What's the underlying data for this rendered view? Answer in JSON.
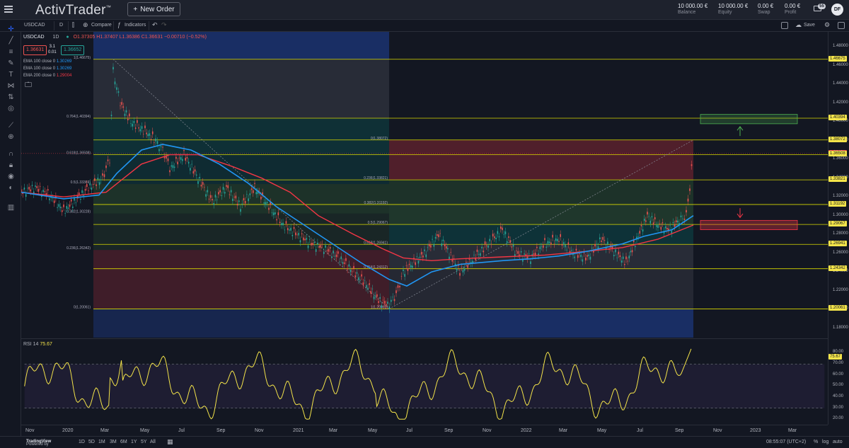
{
  "app": {
    "brand": "ActivTrader",
    "brand_tm": "™",
    "new_order_label": "New Order"
  },
  "account": [
    {
      "value": "10 000.00 €",
      "label": "Balance"
    },
    {
      "value": "10 000.00 €",
      "label": "Equity"
    },
    {
      "value": "0.00 €",
      "label": "Swap"
    },
    {
      "value": "0.00 €",
      "label": "Profit"
    }
  ],
  "notifications": {
    "count": "55"
  },
  "user": {
    "initials": "DF"
  },
  "chart_toolbar": {
    "symbol": "USDCAD",
    "interval": "D",
    "compare_label": "Compare",
    "indicators_label": "Indicators",
    "save_label": "Save"
  },
  "legend": {
    "symbol": "USDCAD",
    "interval": "1D",
    "ohlc": "O1.37305  H1.37407  L1.36386  C1.36631  −0.00710 (−0.52%)",
    "sell_price": "1.36631",
    "spread": "3.1",
    "lot": "0.01",
    "buy_price": "1.36652",
    "emas": [
      {
        "label": "EMA 100 close 0",
        "value": "1.30269",
        "color": "#2196f3"
      },
      {
        "label": "EMA 100 close 0",
        "value": "1.30269",
        "color": "#2196f3"
      },
      {
        "label": "EMA 200 close 0",
        "value": "1.29004",
        "color": "#f23645"
      }
    ]
  },
  "fib_left": [
    {
      "label": "1(1.46675)",
      "value": 1.46675
    },
    {
      "label": "0.764(1.40394)",
      "value": 1.40394
    },
    {
      "label": "0.618(1.36508)",
      "value": 1.36508
    },
    {
      "label": "0.5(1.33369)",
      "value": 1.33369
    },
    {
      "label": "0.382(1.30228)",
      "value": 1.30228
    },
    {
      "label": "0.236(1.26342)",
      "value": 1.26342
    },
    {
      "label": "0(1.20061)",
      "value": 1.20061
    }
  ],
  "fib_right": [
    {
      "label": "0(1.38072)",
      "value": 1.38072
    },
    {
      "label": "0.236(1.33821)",
      "value": 1.33821
    },
    {
      "label": "0.382(1.31192)",
      "value": 1.31192
    },
    {
      "label": "0.5(1.29067)",
      "value": 1.29067
    },
    {
      "label": "0.618(1.26941)",
      "value": 1.26941
    },
    {
      "label": "0.764(1.24312)",
      "value": 1.24312
    },
    {
      "label": "1(1.20061)",
      "value": 1.20061
    }
  ],
  "price_scale": {
    "ticks": [
      "1.48000",
      "1.46000",
      "1.44000",
      "1.42000",
      "1.40000",
      "1.38000",
      "1.36000",
      "1.34000",
      "1.32000",
      "1.30000",
      "1.28000",
      "1.26000",
      "1.24000",
      "1.22000",
      "1.20000",
      "1.18000"
    ],
    "levels": [
      {
        "label": "1.46675",
        "value": 1.46675,
        "kind": "level"
      },
      {
        "label": "1.40394",
        "value": 1.40394,
        "kind": "level"
      },
      {
        "label": "1.38072",
        "value": 1.38072,
        "kind": "level"
      },
      {
        "label": "1.36631",
        "value": 1.36631,
        "kind": "current"
      },
      {
        "label": "1.36508",
        "value": 1.36508,
        "kind": "level"
      },
      {
        "label": "1.33821",
        "value": 1.33821,
        "kind": "level"
      },
      {
        "label": "1.31192",
        "value": 1.31192,
        "kind": "level"
      },
      {
        "label": "1.29067",
        "value": 1.29067,
        "kind": "level"
      },
      {
        "label": "1.26941",
        "value": 1.26941,
        "kind": "level"
      },
      {
        "label": "1.24342",
        "value": 1.24342,
        "kind": "level"
      },
      {
        "label": "1.20061",
        "value": 1.20061,
        "kind": "level"
      }
    ],
    "ymin": 1.17,
    "ymax": 1.496
  },
  "rsi": {
    "label": "RSI 14",
    "value": "75.67",
    "ticks": [
      "80.00",
      "70.00",
      "60.00",
      "50.00",
      "40.00",
      "30.00",
      "20.00"
    ],
    "ymin": 15,
    "ymax": 93,
    "upper": 70,
    "lower": 30
  },
  "time_axis": [
    "Nov",
    "2020",
    "Mar",
    "May",
    "Jul",
    "Sep",
    "Nov",
    "2021",
    "Mar",
    "May",
    "Jul",
    "Sep",
    "Nov",
    "2022",
    "Mar",
    "May",
    "Jul",
    "Sep",
    "Nov",
    "2023",
    "Mar"
  ],
  "bottom_bar": {
    "powered": "Powered by",
    "powered_brand": "TradingView",
    "ranges": [
      "1D",
      "5D",
      "1M",
      "3M",
      "6M",
      "1Y",
      "5Y",
      "All"
    ],
    "clock": "08:55:07 (UTC+2)",
    "percent": "%",
    "log": "log",
    "auto": "auto"
  },
  "colors": {
    "bg": "#131722",
    "fib_line": "#d9d900",
    "ema100": "#2196f3",
    "ema200": "#f23645",
    "rsi": "#f5e54a",
    "current": "#f23645"
  }
}
